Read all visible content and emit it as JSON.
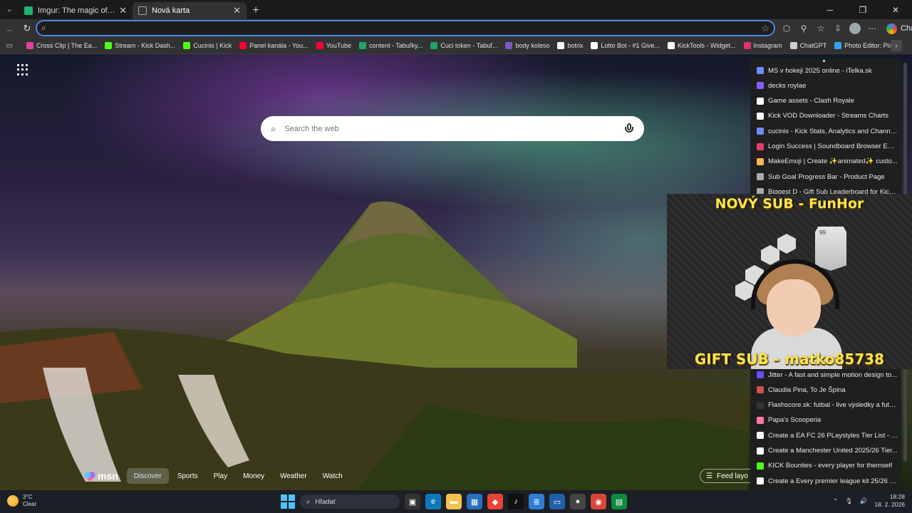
{
  "tabs": [
    {
      "title": "Imgur: The magic of the Internet",
      "favicon_color": "#1bb76e",
      "active": false
    },
    {
      "title": "Nová karta",
      "favicon_color": "#8a8a8a",
      "active": true
    }
  ],
  "toolbar": {
    "omnibox_value": "",
    "chat_label": "Chatovať"
  },
  "bookmarks": [
    {
      "label": "Cross Clip | The Ea...",
      "color": "#e040a0"
    },
    {
      "label": "Stream - Kick Dash...",
      "color": "#53fc18"
    },
    {
      "label": "Cucinis | Kick",
      "color": "#53fc18"
    },
    {
      "label": "Panel kanála - You...",
      "color": "#ff0033"
    },
    {
      "label": "YouTube",
      "color": "#ff0033"
    },
    {
      "label": "content - Tabuľky...",
      "color": "#21a464"
    },
    {
      "label": "Cuci token - Tabuľ...",
      "color": "#21a464"
    },
    {
      "label": "body koleso",
      "color": "#7e57c2"
    },
    {
      "label": "botrix",
      "color": "#ffffff"
    },
    {
      "label": "Lotto Bot - #1 Give...",
      "color": "#ffffff"
    },
    {
      "label": "KickTools - Widget...",
      "color": "#ffffff"
    },
    {
      "label": "Instagram",
      "color": "#e1306c"
    },
    {
      "label": "ChatGPT",
      "color": "#cfcfcf"
    },
    {
      "label": "Photo Editor: Pixlr...",
      "color": "#3aa0ff"
    }
  ],
  "page": {
    "search_placeholder": "Search the web"
  },
  "msn": {
    "logo": "msn",
    "nav": [
      {
        "label": "Discover",
        "active": true
      },
      {
        "label": "Sports",
        "active": false
      },
      {
        "label": "Play",
        "active": false
      },
      {
        "label": "Money",
        "active": false
      },
      {
        "label": "Weather",
        "active": false
      },
      {
        "label": "Watch",
        "active": false
      }
    ],
    "feed_layout": "Feed layo"
  },
  "history_top": [
    {
      "label": "MS v hokeji 2025 online - iTelka.sk",
      "color": "#6f8bff"
    },
    {
      "label": "decks roylae",
      "color": "#8a5cff"
    },
    {
      "label": "Game assets - Clash Royale",
      "color": "#ffffff"
    },
    {
      "label": "Kick VOD Downloader - Streams Charts",
      "color": "#ffffff"
    },
    {
      "label": "cucinis - Kick Stats, Analytics and Channel...",
      "color": "#6f8bff"
    },
    {
      "label": "Login Success | Soundboard Browser Exte...",
      "color": "#e0406a"
    },
    {
      "label": "MakeEmoji | Create ✨animated✨ custo...",
      "color": "#ffb84d"
    },
    {
      "label": "Sub Goal Progress Bar - Product Page",
      "color": "#aaaaaa"
    },
    {
      "label": "Biggest D - Gift Sub Leaderboard for Kick...",
      "color": "#aaaaaa"
    }
  ],
  "history_bottom": [
    {
      "label": "Jitter - A fast and simple motion design to...",
      "color": "#6a4cff"
    },
    {
      "label": "Claudia Pina, To Je Špina",
      "color": "#d0504a"
    },
    {
      "label": "Flashscore.sk: futbal - live výsledky a futb...",
      "color": "#333333"
    },
    {
      "label": "Papa's Scooperia",
      "color": "#ff7aa8"
    },
    {
      "label": "Create a EA FC 26 PLaystyles Tier List - Tie...",
      "color": "#ffffff"
    },
    {
      "label": "Create a Manchester United 2025/26 Tier...",
      "color": "#ffffff"
    },
    {
      "label": "KICK Bounties - every player for themself",
      "color": "#53fc18"
    },
    {
      "label": "Create a Every premier league kit 25/26 Ti...",
      "color": "#ffffff"
    }
  ],
  "overlay": {
    "new_sub": "NOVÝ SUB - FunHor",
    "gift_sub": "GIFT SUB - matko85738",
    "card_rating": "99"
  },
  "taskbar": {
    "temp": "3°C",
    "condition": "Clear",
    "search": "Hľadať",
    "time": "18:28",
    "date": "18. 2. 2026"
  }
}
